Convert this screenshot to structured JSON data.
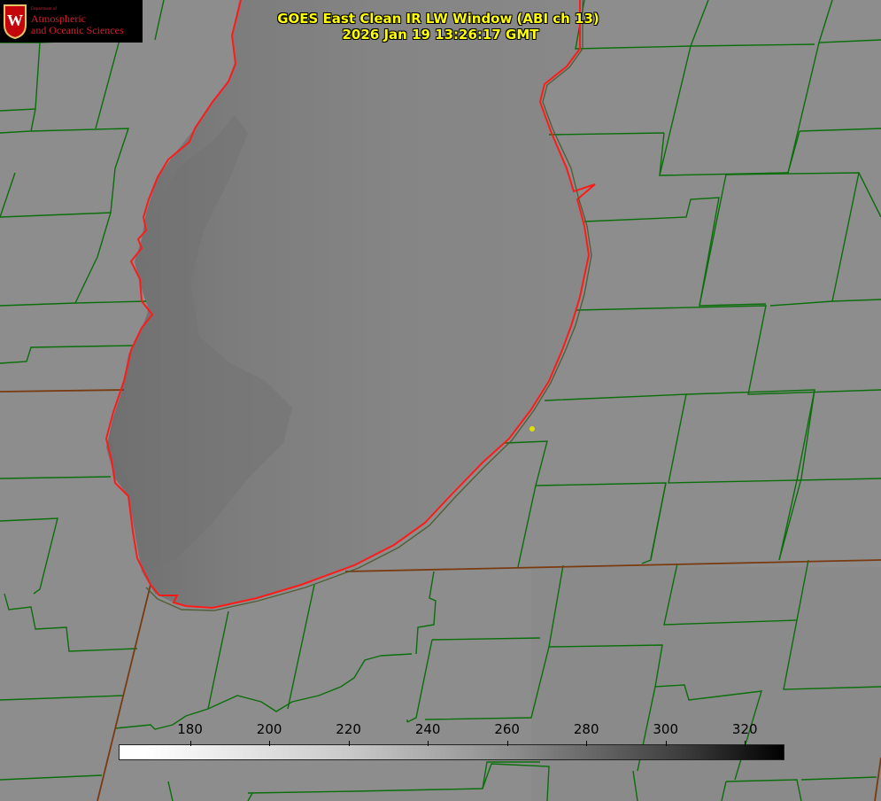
{
  "title": {
    "line1": "GOES East Clean IR LW Window (ABI ch 13)",
    "line2": "2026 Jan 19 13:26:17 GMT"
  },
  "logo": {
    "department": "Department of",
    "line1": "Atmospheric",
    "line2": "and Oceanic Sciences",
    "crest_letter": "W"
  },
  "colorbar": {
    "ticks": [
      "180",
      "200",
      "220",
      "240",
      "260",
      "280",
      "300",
      "320"
    ],
    "min": 162,
    "max": 330,
    "gradient": "white-to-black"
  },
  "colors": {
    "background": "#8c8c8c",
    "lake_fill": "#808080",
    "county_lines": "#0a6e0a",
    "shoreline": "#ff1a1a",
    "state_border": "#7a3a10",
    "title_text": "#ffff00",
    "logo_red": "#d21f2d",
    "marker": "#e0e000"
  }
}
